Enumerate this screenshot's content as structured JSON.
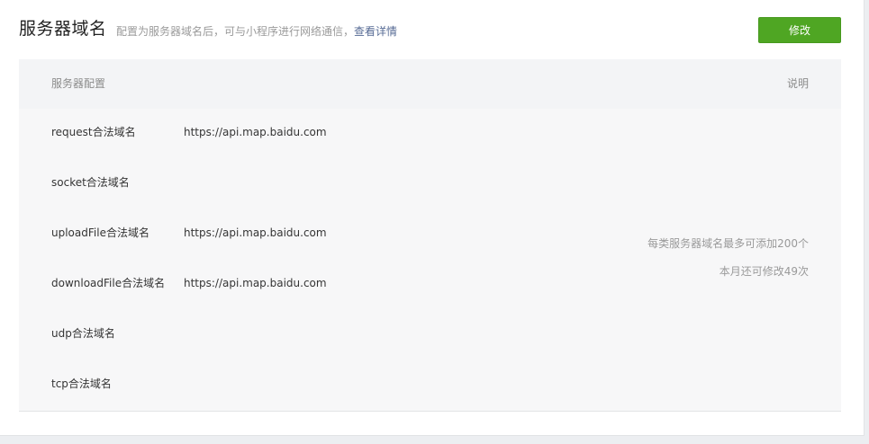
{
  "header": {
    "title": "服务器域名",
    "description": "配置为服务器域名后，可与小程序进行网络通信，",
    "detail_link": "查看详情",
    "edit_button": "修改"
  },
  "table": {
    "col_config": "服务器配置",
    "col_note": "说明",
    "rows": [
      {
        "label": "request合法域名",
        "value": "https://api.map.baidu.com"
      },
      {
        "label": "socket合法域名",
        "value": ""
      },
      {
        "label": "uploadFile合法域名",
        "value": "https://api.map.baidu.com"
      },
      {
        "label": "downloadFile合法域名",
        "value": "https://api.map.baidu.com"
      },
      {
        "label": "udp合法域名",
        "value": ""
      },
      {
        "label": "tcp合法域名",
        "value": ""
      }
    ],
    "notes": [
      "每类服务器域名最多可添加200个",
      "本月还可修改49次"
    ]
  }
}
